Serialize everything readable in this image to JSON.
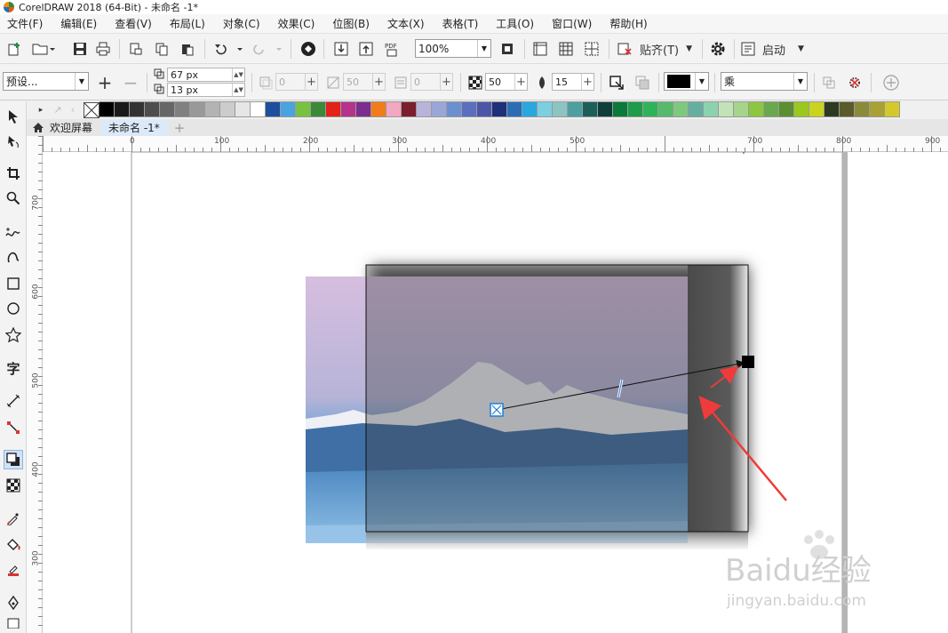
{
  "window": {
    "title": "CorelDRAW 2018 (64-Bit) - 未命名 -1*"
  },
  "menu": [
    "文件(F)",
    "编辑(E)",
    "查看(V)",
    "布局(L)",
    "对象(C)",
    "效果(C)",
    "位图(B)",
    "文本(X)",
    "表格(T)",
    "工具(O)",
    "窗口(W)",
    "帮助(H)"
  ],
  "toolbar": {
    "zoom": "100%",
    "snap_label": "贴齐(T)",
    "launch_label": "启动"
  },
  "propbar": {
    "preset": "预设...",
    "width": "67 px",
    "height": "13 px",
    "val1": "0",
    "val2": "50",
    "val3": "0",
    "opacity": "50",
    "feather": "15",
    "merge_mode": "乘",
    "shadow_color": "#000000"
  },
  "palette_colors": [
    "#000000",
    "#1a1a1a",
    "#333333",
    "#4d4d4d",
    "#666666",
    "#808080",
    "#999999",
    "#b3b3b3",
    "#cccccc",
    "#e6e6e6",
    "#ffffff",
    "#1d4f9c",
    "#4aa3df",
    "#79c142",
    "#3a8a3a",
    "#e2231a",
    "#b5338a",
    "#7b2e8e",
    "#f07d19",
    "#f2a7c3",
    "#7a1f2b",
    "#b8b3d9",
    "#9aa7d6",
    "#6c8fcf",
    "#5b6fbf",
    "#4c56a8",
    "#1f2f78",
    "#2b6db5",
    "#29a8e0",
    "#7ccfe0",
    "#8cc4c4",
    "#4e9f9f",
    "#1c5f5a",
    "#0f3d3a",
    "#0a7a3a",
    "#1e9b4b",
    "#2fb35a",
    "#57b96b",
    "#7fc87f",
    "#64b0a0",
    "#8cd1b0",
    "#c2e3b8",
    "#a6d48a",
    "#8dc63f",
    "#6aa84f",
    "#5c8f2f",
    "#9bc81e",
    "#c8d41e",
    "#2e3a1f",
    "#5a5a2a",
    "#8a8a3a",
    "#a9a136",
    "#d4c92a"
  ],
  "tabs": {
    "welcome": "欢迎屏幕",
    "document": "未命名 -1*"
  },
  "ruler": {
    "h": [
      "0",
      "100",
      "200",
      "300",
      "400",
      "500",
      "700",
      "800",
      "900"
    ],
    "v": [
      "700",
      "600",
      "500",
      "400",
      "300"
    ]
  },
  "watermark": {
    "brand": "Baidu经验",
    "url": "jingyan.baidu.com"
  }
}
